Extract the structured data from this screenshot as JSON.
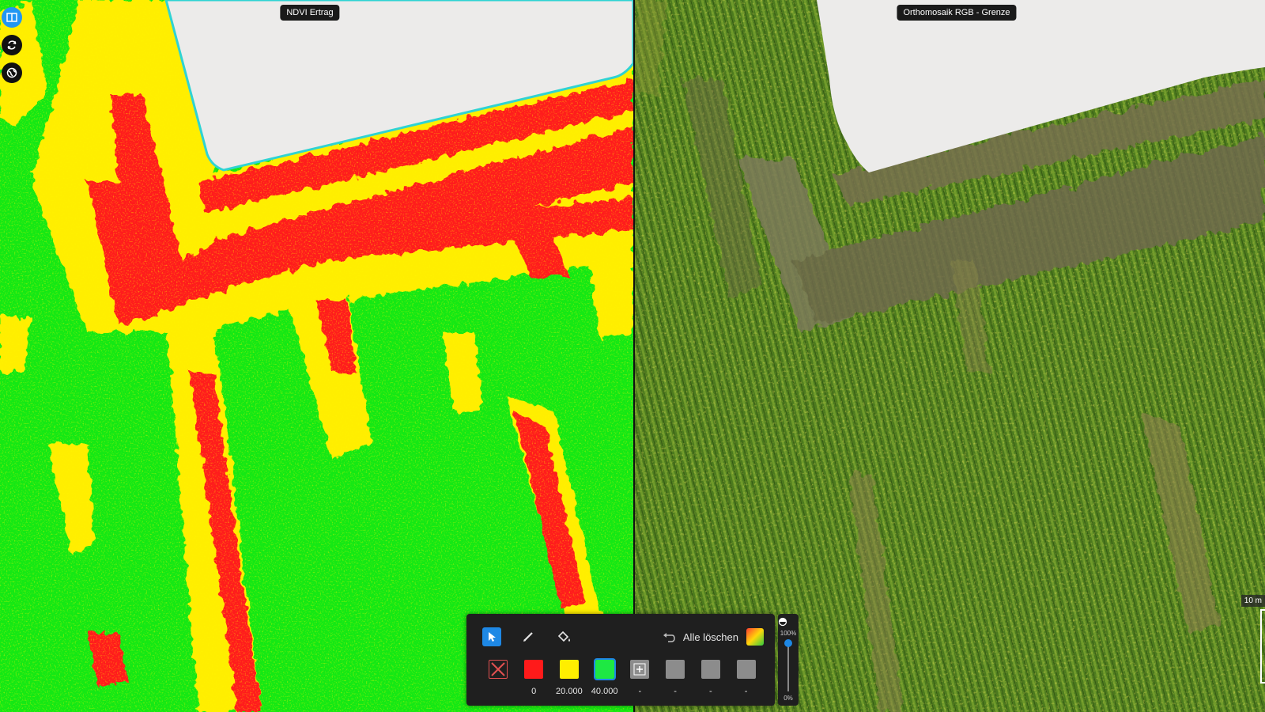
{
  "panes": {
    "left": {
      "label": "NDVI Ertrag"
    },
    "right": {
      "label": "Orthomosaik RGB - Grenze"
    }
  },
  "side_buttons": [
    {
      "icon": "split-view-icon",
      "active": true
    },
    {
      "icon": "sync-icon",
      "active": false
    },
    {
      "icon": "globe-icon",
      "active": false
    }
  ],
  "toolbar": {
    "tools": [
      {
        "icon": "cursor-icon",
        "active": true
      },
      {
        "icon": "pencil-icon",
        "active": false
      },
      {
        "icon": "paint-bucket-icon",
        "active": false
      }
    ],
    "undo_icon": "undo-icon",
    "clear_all_label": "Alle löschen",
    "gradient_icon": "color-gradient-icon",
    "classes": [
      {
        "kind": "none",
        "color": "#1f1f1f",
        "label": ""
      },
      {
        "kind": "color",
        "color": "#ff1a1a",
        "label": "0"
      },
      {
        "kind": "color",
        "color": "#ffee00",
        "label": "20.000"
      },
      {
        "kind": "color",
        "color": "#1ee843",
        "label": "40.000"
      },
      {
        "kind": "add",
        "color": "#8c8c8c",
        "label": "-"
      },
      {
        "kind": "empty",
        "color": "#8c8c8c",
        "label": "-"
      },
      {
        "kind": "empty",
        "color": "#8c8c8c",
        "label": "-"
      },
      {
        "kind": "empty",
        "color": "#8c8c8c",
        "label": "-"
      }
    ]
  },
  "opacity": {
    "max_label": "100%",
    "min_label": "0%",
    "value": 1.0
  },
  "scale": {
    "label": "10 m"
  },
  "colors": {
    "ndvi_high": "#14e814",
    "ndvi_mid": "#ffee00",
    "ndvi_low": "#ff1a1a",
    "boundary": "#2fd3d3",
    "background": "#ecebea"
  }
}
